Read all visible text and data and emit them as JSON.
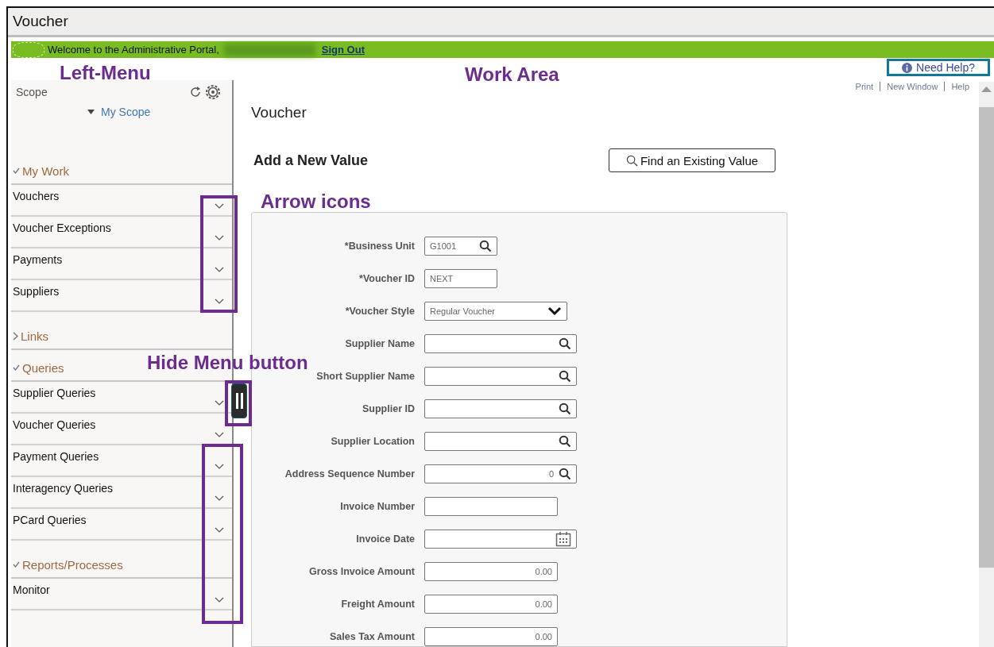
{
  "window": {
    "title": "Voucher"
  },
  "banner": {
    "welcome": "Welcome to the Administrative Portal,",
    "sign_out": "Sign Out"
  },
  "left_menu": {
    "scope_label": "Scope",
    "scope_link": "My Scope",
    "sections": [
      {
        "title": "My Work",
        "expanded": true,
        "items": [
          "Vouchers",
          "Voucher Exceptions",
          "Payments",
          "Suppliers"
        ]
      },
      {
        "title": "Links",
        "expanded": false
      },
      {
        "title": "Queries",
        "expanded": true,
        "items": [
          "Supplier Queries",
          "Voucher Queries",
          "Payment Queries",
          "Interagency Queries",
          "PCard Queries"
        ]
      },
      {
        "title": "Reports/Processes",
        "expanded": true,
        "items": [
          "Monitor"
        ]
      }
    ]
  },
  "help_button": "Need Help?",
  "top_links": [
    "Print",
    "New Window",
    "Help"
  ],
  "page_title": "Voucher",
  "add_heading": "Add a New Value",
  "find_button": "Find an Existing Value",
  "form": [
    {
      "label": "*Business Unit",
      "kind": "short_lookup",
      "value": "G1001"
    },
    {
      "label": "*Voucher ID",
      "kind": "short_text",
      "value": "NEXT"
    },
    {
      "label": "*Voucher Style",
      "kind": "select",
      "value": "Regular Voucher"
    },
    {
      "label": "Supplier Name",
      "kind": "lookup"
    },
    {
      "label": "Short Supplier Name",
      "kind": "lookup"
    },
    {
      "label": "Supplier ID",
      "kind": "lookup"
    },
    {
      "label": "Supplier Location",
      "kind": "lookup"
    },
    {
      "label": "Address Sequence Number",
      "kind": "lookup",
      "value": "0"
    },
    {
      "label": "Invoice Number",
      "kind": "text"
    },
    {
      "label": "Invoice Date",
      "kind": "date"
    },
    {
      "label": "Gross Invoice Amount",
      "kind": "amount",
      "value": "0.00"
    },
    {
      "label": "Freight Amount",
      "kind": "amount",
      "value": "0.00"
    },
    {
      "label": "Sales Tax Amount",
      "kind": "amount",
      "value": "0.00"
    }
  ],
  "annotations": [
    "Left-Menu",
    "Work Area",
    "Arrow icons",
    "Hide Menu button"
  ]
}
